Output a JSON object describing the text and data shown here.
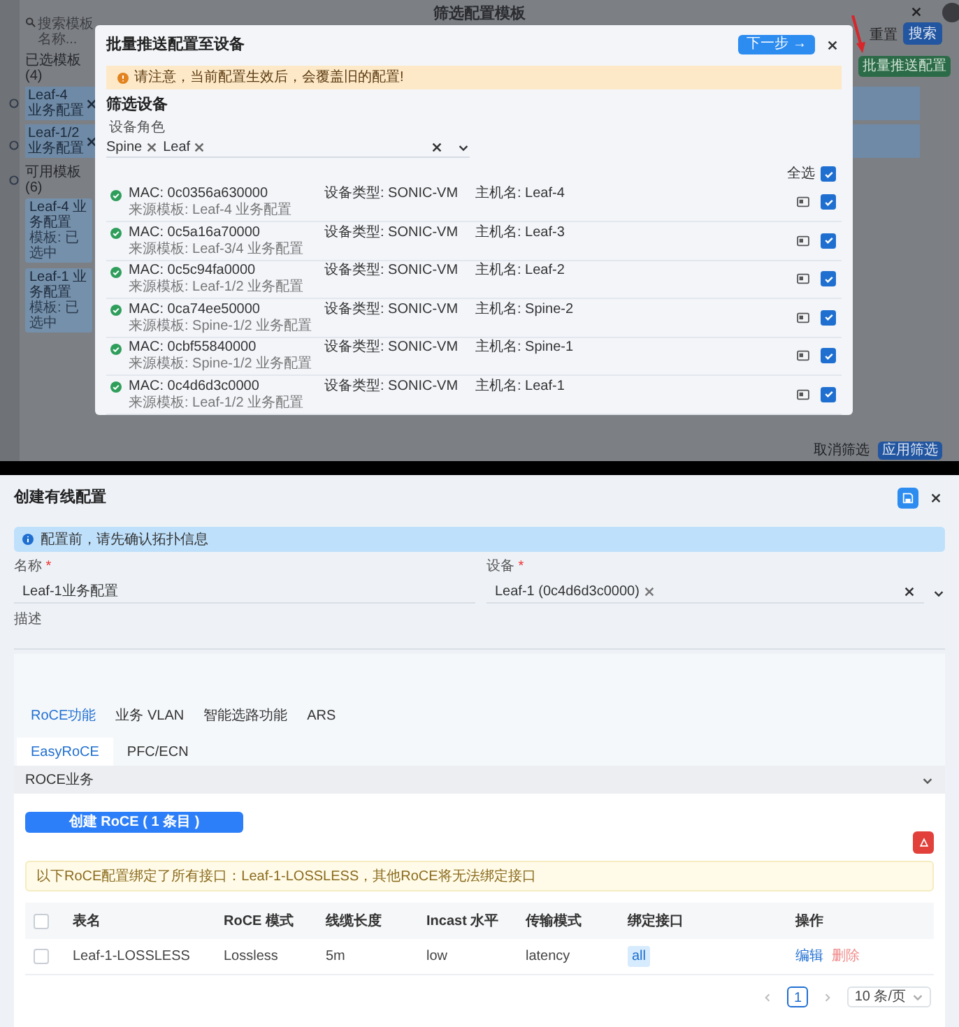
{
  "background_app": {
    "title": "筛选配置模板",
    "search": {
      "placeholder": "搜索模板名称..."
    },
    "reset_button": "重置",
    "search_button": "搜索",
    "push_button": "批量推送配置",
    "selected_heading": "已选模板 (4)",
    "selected_templates": [
      "Leaf-4 业务配置",
      "Leaf-1/2 业务配置"
    ],
    "available_heading": "可用模板 (6)",
    "available_templates": [
      {
        "name": "Leaf-4 业务配置",
        "subtitle": "模板: 已选中"
      },
      {
        "name": "Leaf-1 业务配置",
        "subtitle": "模板: 已选中"
      }
    ],
    "footer_buttons": [
      {
        "label": "取消筛选",
        "kind": "plain"
      },
      {
        "label": "应用筛选",
        "kind": "primary"
      }
    ]
  },
  "push_dialog": {
    "title": "批量推送配置至设备",
    "next_button": "下一步 →",
    "warning": "请注意，当前配置生效后，会覆盖旧的配置!",
    "filter_heading": "筛选设备",
    "role_label": "设备角色",
    "roles": [
      "Spine",
      "Leaf"
    ],
    "select_all": {
      "label": "全选",
      "checked": true
    },
    "devices": [
      {
        "mac_label": "MAC:",
        "mac": "0c0356a630000",
        "type_label": "设备类型:",
        "type": "SONIC-VM",
        "host_label": "主机名:",
        "host": "Leaf-4",
        "source": "来源模板: Leaf-4 业务配置",
        "checked": true
      },
      {
        "mac_label": "MAC:",
        "mac": "0c5a16a70000",
        "type_label": "设备类型:",
        "type": "SONIC-VM",
        "host_label": "主机名:",
        "host": "Leaf-3",
        "source": "来源模板: Leaf-3/4 业务配置",
        "checked": true
      },
      {
        "mac_label": "MAC:",
        "mac": "0c5c94fa0000",
        "type_label": "设备类型:",
        "type": "SONIC-VM",
        "host_label": "主机名:",
        "host": "Leaf-2",
        "source": "来源模板: Leaf-1/2 业务配置",
        "checked": true
      },
      {
        "mac_label": "MAC:",
        "mac": "0ca74ee50000",
        "type_label": "设备类型:",
        "type": "SONIC-VM",
        "host_label": "主机名:",
        "host": "Spine-2",
        "source": "来源模板: Spine-1/2 业务配置",
        "checked": true
      },
      {
        "mac_label": "MAC:",
        "mac": "0cbf55840000",
        "type_label": "设备类型:",
        "type": "SONIC-VM",
        "host_label": "主机名:",
        "host": "Spine-1",
        "source": "来源模板: Spine-1/2 业务配置",
        "checked": true
      },
      {
        "mac_label": "MAC:",
        "mac": "0c4d6d3c0000",
        "type_label": "设备类型:",
        "type": "SONIC-VM",
        "host_label": "主机名:",
        "host": "Leaf-1",
        "source": "来源模板: Leaf-1/2 业务配置",
        "checked": true
      }
    ]
  },
  "wired_config": {
    "title": "创建有线配置",
    "info": "配置前，请先确认拓扑信息",
    "name_label": "名称",
    "name_required_mark": "*",
    "name_value": "Leaf-1业务配置",
    "device_label": "设备",
    "device_required_mark": "*",
    "device_value": "Leaf-1 (0c4d6d3c0000)",
    "description_label": "描述",
    "tabs": [
      {
        "label": "RoCE功能",
        "selected": true
      },
      {
        "label": "业务 VLAN",
        "selected": false
      },
      {
        "label": "智能选路功能",
        "selected": false
      },
      {
        "label": "ARS",
        "selected": false
      }
    ],
    "subtabs": [
      {
        "label": "EasyRoCE",
        "selected": true
      },
      {
        "label": "PFC/ECN",
        "selected": false
      }
    ],
    "section": "ROCE业务",
    "create_button": "创建 RoCE ( 1 条目 )",
    "notice": "以下RoCE配置绑定了所有接口：Leaf-1-LOSSLESS，其他RoCE将无法绑定接口",
    "table": {
      "columns": [
        "表名",
        "RoCE 模式",
        "线缆长度",
        "Incast 水平",
        "传输模式",
        "绑定接口",
        "操作"
      ],
      "select_all_checked": false,
      "rows": [
        {
          "checked": false,
          "name": "Leaf-1-LOSSLESS",
          "mode": "Lossless",
          "cable": "5m",
          "incast": "low",
          "transport": "latency",
          "interface": "all",
          "actions": [
            "编辑",
            "删除"
          ]
        }
      ]
    },
    "pagination": {
      "page": "1",
      "page_size": "10 条/页"
    }
  }
}
